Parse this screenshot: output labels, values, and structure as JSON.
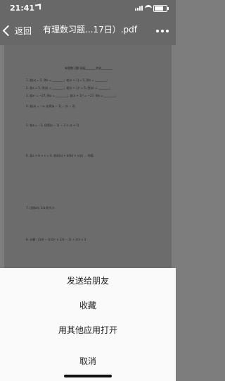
{
  "status": {
    "time": "21:41"
  },
  "nav": {
    "back_label": "返回",
    "title": "有理数习题...17日）.pdf"
  },
  "document": {
    "header": "有理数习题 班级_______ 姓名________",
    "questions": [
      "1. 若|x| = 5, 则x = ________；若|x + 1| = 5, 则x = ________；",
      "2. 若x = 5, 则|x| = ________；若|x + 1|² = 5, 则|x| = ________；",
      "3. 若x² = −27, 则x = ________；若(x + 1)² = −27, 则x = ________；",
      "4. 若|a| = −a, 化简|a − 1| − |a − 2|.",
      "5. 若a = −1, 化简|a − 1| − 3 + |a + 1|.",
      "6. 若a + b + c = 0, 求a/|a| + b/|b| + c/|c| ... 的值.",
      "7. 比较a与 1/a 的大小.",
      "8. 计算：[3/4 − (1/2)² × 2/3 − 3] ÷ 2/3 × 3"
    ]
  },
  "sheet": {
    "actions": [
      "发送给朋友",
      "收藏",
      "用其他应用打开"
    ],
    "cancel_label": "取消"
  }
}
